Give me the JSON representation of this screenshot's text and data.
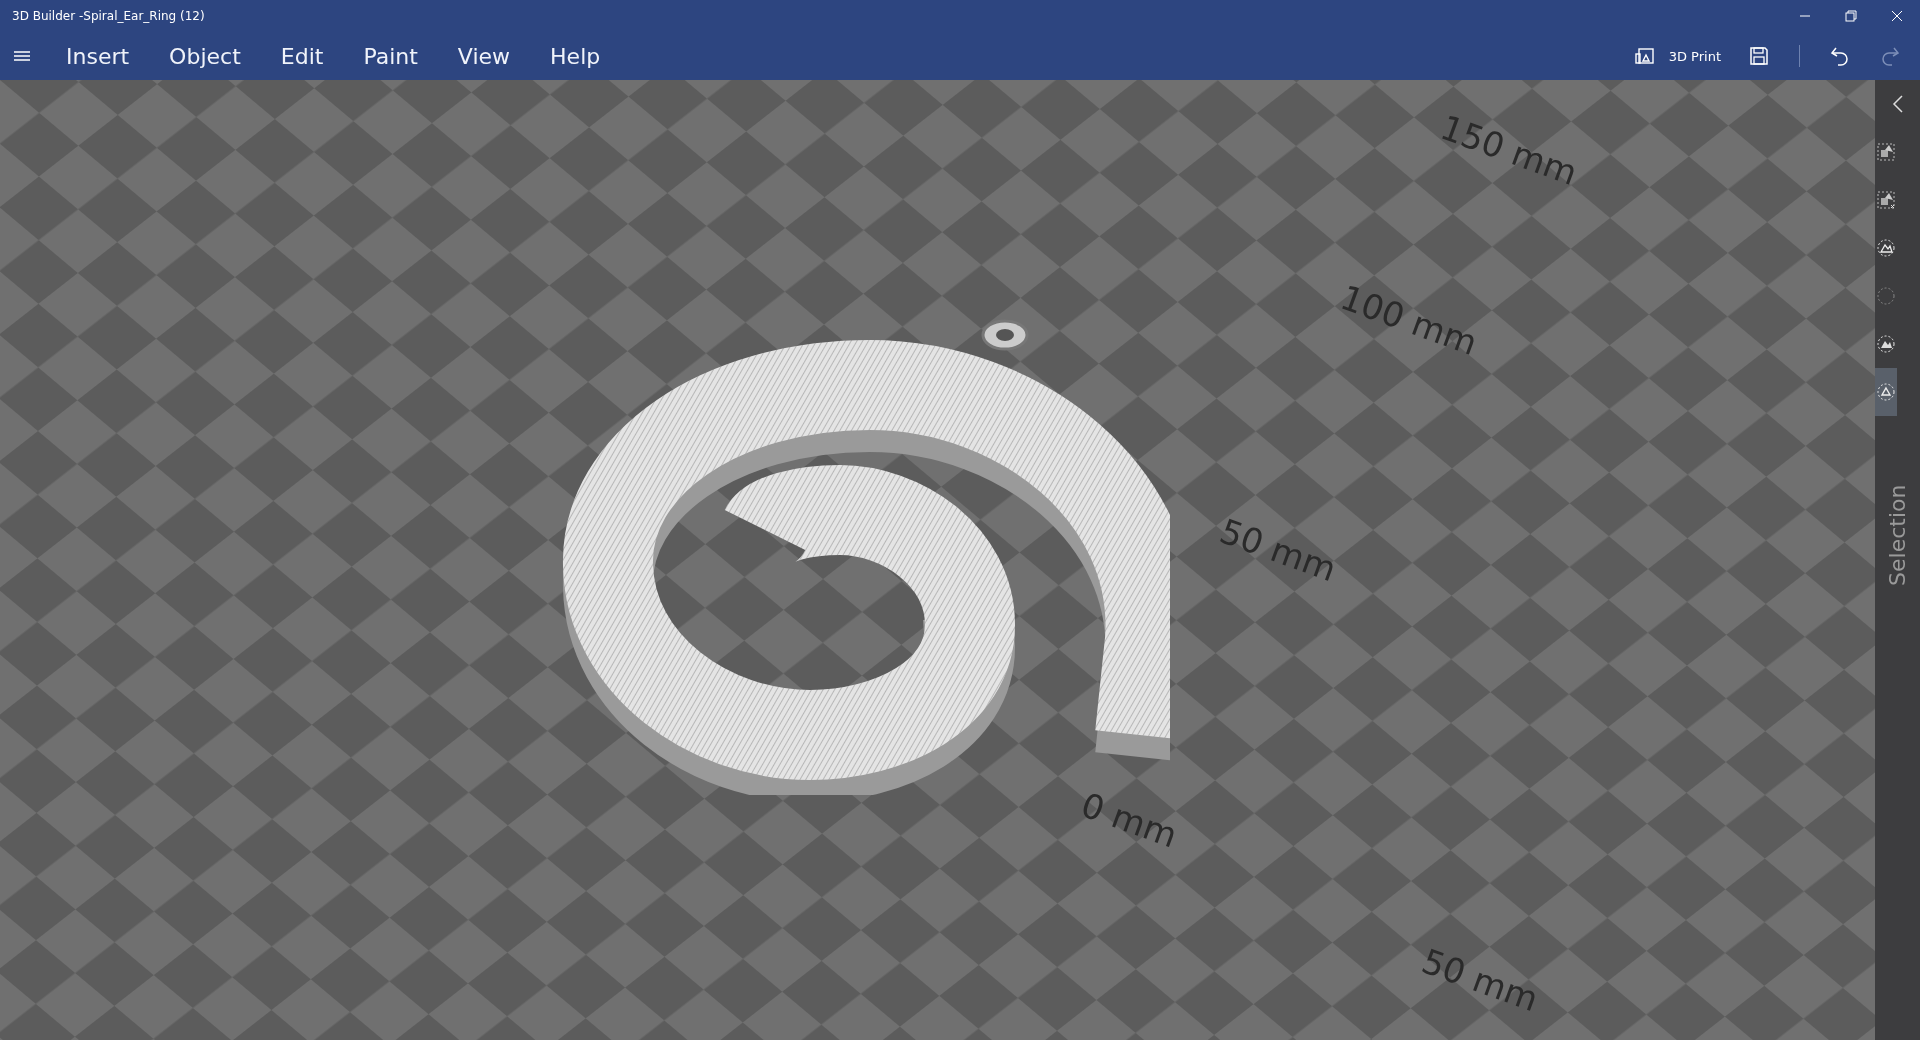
{
  "window": {
    "title": "3D Builder -Spiral_Ear_Ring (12)"
  },
  "menu": [
    {
      "label": "Insert"
    },
    {
      "label": "Object"
    },
    {
      "label": "Edit"
    },
    {
      "label": "Paint"
    },
    {
      "label": "View"
    },
    {
      "label": "Help"
    }
  ],
  "toolbar": {
    "print_label": "3D Print",
    "redo_disabled": true
  },
  "axis_labels": [
    {
      "text": "150 mm",
      "kind": "far"
    },
    {
      "text": "100 mm",
      "kind": "mid"
    },
    {
      "text": "50 mm",
      "kind": "near"
    },
    {
      "text": "0 mm",
      "kind": "origin"
    },
    {
      "text": "50 mm",
      "kind": "side"
    }
  ],
  "side_panel": {
    "title": "Selection",
    "tools": [
      {
        "kind": "select-objects",
        "selected": false
      },
      {
        "kind": "deselect-objects",
        "selected": false
      },
      {
        "kind": "select-mesh",
        "selected": false
      },
      {
        "kind": "select-empty",
        "selected": false
      },
      {
        "kind": "select-faces",
        "selected": false
      },
      {
        "kind": "select-triangle",
        "selected": true
      }
    ]
  }
}
